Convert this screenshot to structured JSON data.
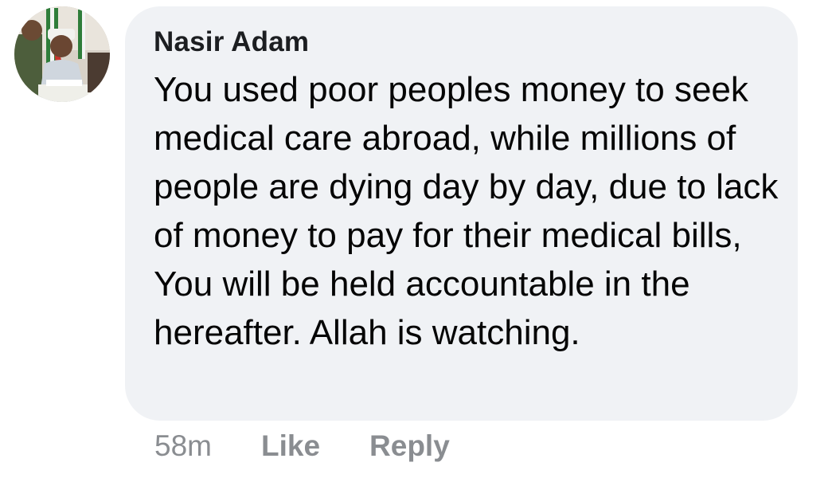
{
  "comment": {
    "author": "Nasir Adam",
    "text": "You used poor peoples money to seek medical care abroad, while millions of people are dying day by day, due to lack of money to pay for their medical bills, You will be held accountable in the hereafter. Allah is watching.",
    "timestamp": "58m",
    "like_label": "Like",
    "reply_label": "Reply",
    "avatar_icon": "profile-photo"
  },
  "colors": {
    "bubble_background": "#f0f2f5",
    "text": "#050505",
    "meta_text": "#8a8d91"
  }
}
